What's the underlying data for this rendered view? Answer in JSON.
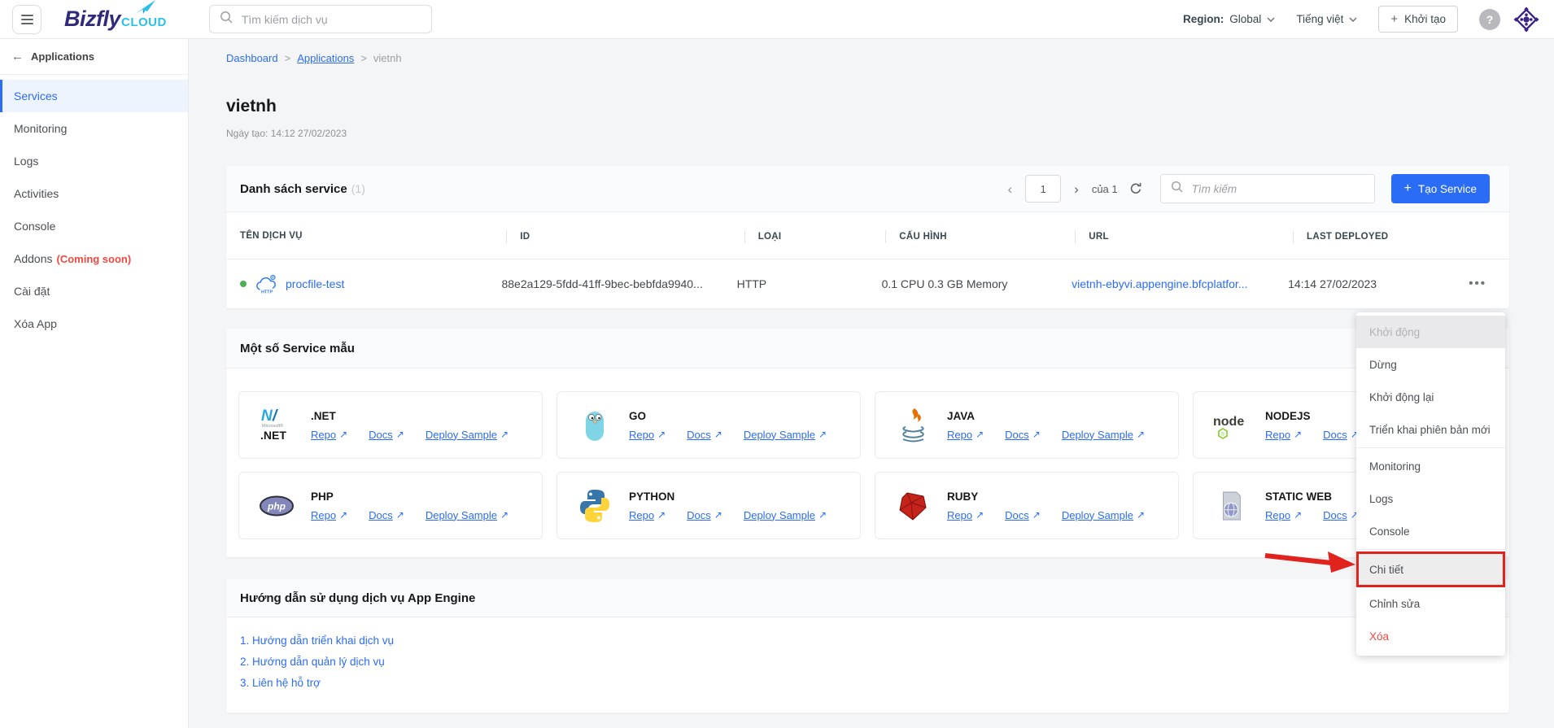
{
  "header": {
    "logo": {
      "brand": "Bizfly",
      "suffix": "CLOUD",
      "icon": "paper-plane-icon"
    },
    "search_placeholder": "Tìm kiếm dịch vụ",
    "region_label": "Region:",
    "region_value": "Global",
    "language": "Tiếng việt",
    "create_label": "Khởi tạo",
    "help_icon": "question-icon",
    "apps_icon": "ecosystem-icon"
  },
  "sidebar": {
    "back_label": "Applications",
    "items": [
      {
        "label": "Services",
        "active": true
      },
      {
        "label": "Monitoring"
      },
      {
        "label": "Logs"
      },
      {
        "label": "Activities"
      },
      {
        "label": "Console"
      },
      {
        "label": "Addons",
        "badge": "(Coming soon)"
      },
      {
        "label": "Cài đặt"
      },
      {
        "label": "Xóa App"
      }
    ]
  },
  "breadcrumb": {
    "separator": ">",
    "items": [
      "Dashboard",
      "Applications",
      "vietnh"
    ]
  },
  "page": {
    "title": "vietnh",
    "created": "Ngày tạo: 14:12 27/02/2023"
  },
  "service_list": {
    "title": "Danh sách service",
    "count": "(1)",
    "pagination": {
      "page": "1",
      "of_label": "của 1"
    },
    "search_placeholder": "Tìm kiếm",
    "create_label": "Tạo Service",
    "columns": [
      "TÊN DỊCH VỤ",
      "ID",
      "LOẠI",
      "CẤU HÌNH",
      "URL",
      "LAST DEPLOYED"
    ],
    "row": {
      "status_color": "#4caf50",
      "icon": "http-cloud-icon",
      "name": "procfile-test",
      "id": "88e2a129-5fdd-41ff-9bec-bebfda9940...",
      "type": "HTTP",
      "config": "0.1 CPU 0.3 GB Memory",
      "url": "vietnh-ebyvi.appengine.bfcplatfor...",
      "last_deployed": "14:14 27/02/2023"
    }
  },
  "templates": {
    "title": "Một số Service mẫu",
    "link_labels": {
      "repo": "Repo",
      "docs": "Docs",
      "deploy": "Deploy Sample"
    },
    "cards": [
      {
        "name": ".NET",
        "icon": "dotnet-icon"
      },
      {
        "name": "GO",
        "icon": "go-icon"
      },
      {
        "name": "JAVA",
        "icon": "java-icon"
      },
      {
        "name": "NODEJS",
        "icon": "nodejs-icon"
      },
      {
        "name": "PHP",
        "icon": "php-icon"
      },
      {
        "name": "PYTHON",
        "icon": "python-icon"
      },
      {
        "name": "RUBY",
        "icon": "ruby-icon"
      },
      {
        "name": "STATIC WEB",
        "icon": "static-web-icon"
      }
    ]
  },
  "guide": {
    "title": "Hướng dẫn sử dụng dịch vụ App Engine",
    "links": [
      "1. Hướng dẫn triển khai dịch vụ",
      "2. Hướng dẫn quản lý dịch vụ",
      "3. Liên hệ hỗ trợ"
    ]
  },
  "context_menu": {
    "items": [
      {
        "label": "Khởi động",
        "disabled": true
      },
      {
        "label": "Dừng"
      },
      {
        "label": "Khởi động lại"
      },
      {
        "label": "Triển khai phiên bản mới"
      },
      {
        "label": "Monitoring"
      },
      {
        "label": "Logs"
      },
      {
        "label": "Console"
      },
      {
        "label": "Chi tiết",
        "highlighted": true
      },
      {
        "label": "Chỉnh sửa"
      },
      {
        "label": "Xóa",
        "danger": true
      }
    ]
  },
  "colors": {
    "accent": "#2b6cf6",
    "danger": "#e0231c",
    "success": "#4caf50",
    "brand_navy": "#2f2a7a",
    "brand_cyan": "#29c1e7"
  }
}
